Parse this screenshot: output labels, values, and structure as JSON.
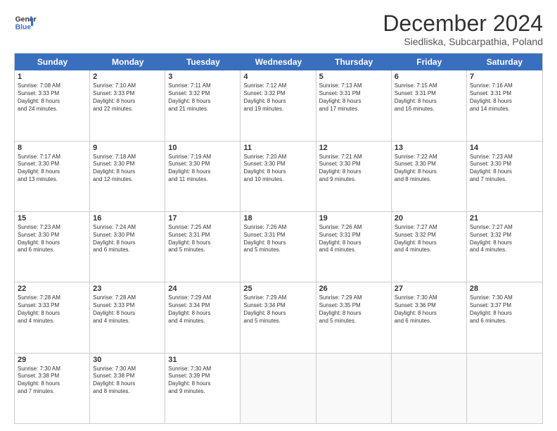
{
  "logo": {
    "line1": "General",
    "line2": "Blue"
  },
  "title": "December 2024",
  "subtitle": "Siedliska, Subcarpathia, Poland",
  "days_of_week": [
    "Sunday",
    "Monday",
    "Tuesday",
    "Wednesday",
    "Thursday",
    "Friday",
    "Saturday"
  ],
  "weeks": [
    [
      {
        "day": "1",
        "text": "Sunrise: 7:08 AM\nSunset: 3:33 PM\nDaylight: 8 hours\nand 24 minutes."
      },
      {
        "day": "2",
        "text": "Sunrise: 7:10 AM\nSunset: 3:33 PM\nDaylight: 8 hours\nand 22 minutes."
      },
      {
        "day": "3",
        "text": "Sunrise: 7:11 AM\nSunset: 3:32 PM\nDaylight: 8 hours\nand 21 minutes."
      },
      {
        "day": "4",
        "text": "Sunrise: 7:12 AM\nSunset: 3:32 PM\nDaylight: 8 hours\nand 19 minutes."
      },
      {
        "day": "5",
        "text": "Sunrise: 7:13 AM\nSunset: 3:31 PM\nDaylight: 8 hours\nand 17 minutes."
      },
      {
        "day": "6",
        "text": "Sunrise: 7:15 AM\nSunset: 3:31 PM\nDaylight: 8 hours\nand 16 minutes."
      },
      {
        "day": "7",
        "text": "Sunrise: 7:16 AM\nSunset: 3:31 PM\nDaylight: 8 hours\nand 14 minutes."
      }
    ],
    [
      {
        "day": "8",
        "text": "Sunrise: 7:17 AM\nSunset: 3:30 PM\nDaylight: 8 hours\nand 13 minutes."
      },
      {
        "day": "9",
        "text": "Sunrise: 7:18 AM\nSunset: 3:30 PM\nDaylight: 8 hours\nand 12 minutes."
      },
      {
        "day": "10",
        "text": "Sunrise: 7:19 AM\nSunset: 3:30 PM\nDaylight: 8 hours\nand 11 minutes."
      },
      {
        "day": "11",
        "text": "Sunrise: 7:20 AM\nSunset: 3:30 PM\nDaylight: 8 hours\nand 10 minutes."
      },
      {
        "day": "12",
        "text": "Sunrise: 7:21 AM\nSunset: 3:30 PM\nDaylight: 8 hours\nand 9 minutes."
      },
      {
        "day": "13",
        "text": "Sunrise: 7:22 AM\nSunset: 3:30 PM\nDaylight: 8 hours\nand 8 minutes."
      },
      {
        "day": "14",
        "text": "Sunrise: 7:23 AM\nSunset: 3:30 PM\nDaylight: 8 hours\nand 7 minutes."
      }
    ],
    [
      {
        "day": "15",
        "text": "Sunrise: 7:23 AM\nSunset: 3:30 PM\nDaylight: 8 hours\nand 6 minutes."
      },
      {
        "day": "16",
        "text": "Sunrise: 7:24 AM\nSunset: 3:30 PM\nDaylight: 8 hours\nand 6 minutes."
      },
      {
        "day": "17",
        "text": "Sunrise: 7:25 AM\nSunset: 3:31 PM\nDaylight: 8 hours\nand 5 minutes."
      },
      {
        "day": "18",
        "text": "Sunrise: 7:26 AM\nSunset: 3:31 PM\nDaylight: 8 hours\nand 5 minutes."
      },
      {
        "day": "19",
        "text": "Sunrise: 7:26 AM\nSunset: 3:31 PM\nDaylight: 8 hours\nand 4 minutes."
      },
      {
        "day": "20",
        "text": "Sunrise: 7:27 AM\nSunset: 3:32 PM\nDaylight: 8 hours\nand 4 minutes."
      },
      {
        "day": "21",
        "text": "Sunrise: 7:27 AM\nSunset: 3:32 PM\nDaylight: 8 hours\nand 4 minutes."
      }
    ],
    [
      {
        "day": "22",
        "text": "Sunrise: 7:28 AM\nSunset: 3:33 PM\nDaylight: 8 hours\nand 4 minutes."
      },
      {
        "day": "23",
        "text": "Sunrise: 7:28 AM\nSunset: 3:33 PM\nDaylight: 8 hours\nand 4 minutes."
      },
      {
        "day": "24",
        "text": "Sunrise: 7:29 AM\nSunset: 3:34 PM\nDaylight: 8 hours\nand 4 minutes."
      },
      {
        "day": "25",
        "text": "Sunrise: 7:29 AM\nSunset: 3:34 PM\nDaylight: 8 hours\nand 5 minutes."
      },
      {
        "day": "26",
        "text": "Sunrise: 7:29 AM\nSunset: 3:35 PM\nDaylight: 8 hours\nand 5 minutes."
      },
      {
        "day": "27",
        "text": "Sunrise: 7:30 AM\nSunset: 3:36 PM\nDaylight: 8 hours\nand 6 minutes."
      },
      {
        "day": "28",
        "text": "Sunrise: 7:30 AM\nSunset: 3:37 PM\nDaylight: 8 hours\nand 6 minutes."
      }
    ],
    [
      {
        "day": "29",
        "text": "Sunrise: 7:30 AM\nSunset: 3:38 PM\nDaylight: 8 hours\nand 7 minutes."
      },
      {
        "day": "30",
        "text": "Sunrise: 7:30 AM\nSunset: 3:38 PM\nDaylight: 8 hours\nand 8 minutes."
      },
      {
        "day": "31",
        "text": "Sunrise: 7:30 AM\nSunset: 3:39 PM\nDaylight: 8 hours\nand 9 minutes."
      },
      {
        "day": "",
        "text": ""
      },
      {
        "day": "",
        "text": ""
      },
      {
        "day": "",
        "text": ""
      },
      {
        "day": "",
        "text": ""
      }
    ]
  ]
}
